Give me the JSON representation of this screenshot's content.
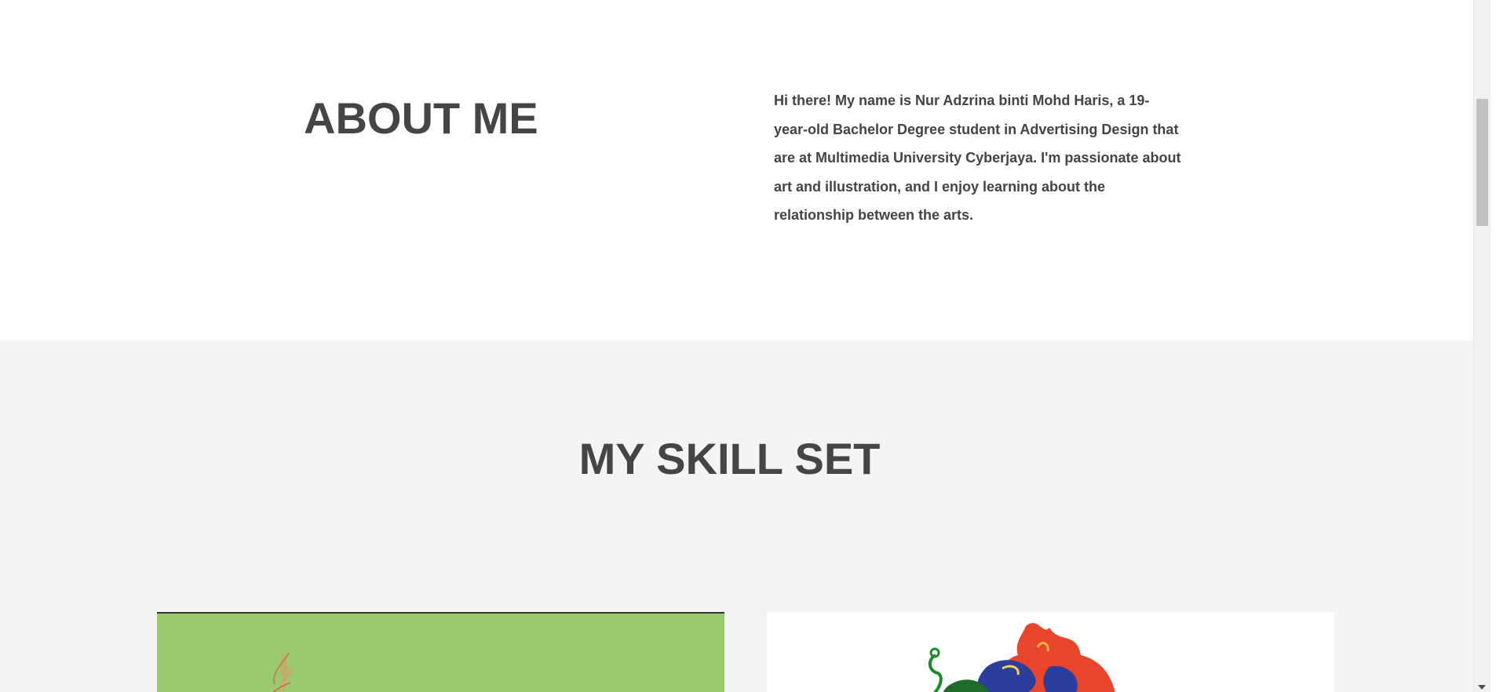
{
  "about": {
    "title": "ABOUT ME",
    "text": " Hi there! My name is Nur Adzrina binti Mohd Haris, a 19-year-old Bachelor Degree student in Advertising Design that are at Multimedia University Cyberjaya. I'm passionate about art and illustration, and I enjoy learning about the relationship between the arts."
  },
  "skills": {
    "title": "MY SKILL SET",
    "cards": [
      {
        "image": "green-artwork-thumbnail"
      },
      {
        "image": "colorful-illustration-thumbnail"
      }
    ]
  },
  "colors": {
    "heading": "#454545",
    "text": "#444444",
    "skills_bg": "#f4f4f4",
    "card_green": "#9aca6e"
  }
}
